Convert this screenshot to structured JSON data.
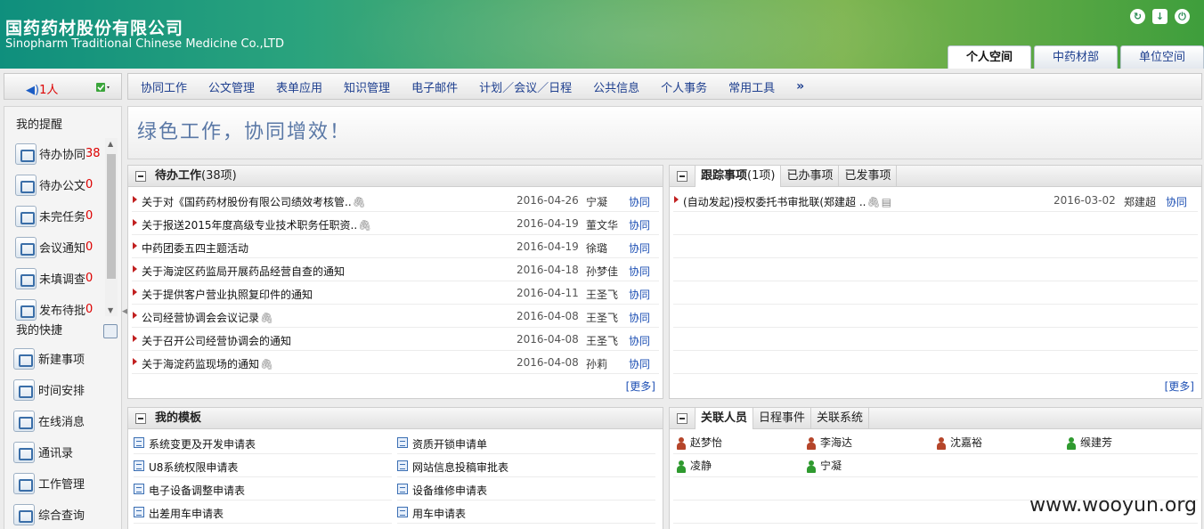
{
  "brand": {
    "cn": "国药药材股份有限公司",
    "en": "Sinopharm Traditional Chinese Medicine Co.,LTD"
  },
  "space_tabs": [
    "个人空间",
    "中药材部",
    "单位空间"
  ],
  "online": {
    "count": "1人"
  },
  "nav": [
    "协同工作",
    "公文管理",
    "表单应用",
    "知识管理",
    "电子邮件",
    "计划／会议／日程",
    "公共信息",
    "个人事务",
    "常用工具"
  ],
  "nav_more": "»",
  "banner": "绿色工作，协同增效！",
  "sidebar": {
    "reminders_title": "我的提醒",
    "reminders": [
      {
        "label": "待办协同",
        "count": "38"
      },
      {
        "label": "待办公文",
        "count": "0"
      },
      {
        "label": "未完任务",
        "count": "0"
      },
      {
        "label": "会议通知",
        "count": "0"
      },
      {
        "label": "未填调查",
        "count": "0"
      },
      {
        "label": "发布待批",
        "count": "0"
      }
    ],
    "shortcuts_title": "我的快捷",
    "shortcuts": [
      "新建事项",
      "时间安排",
      "在线消息",
      "通讯录",
      "工作管理",
      "综合查询"
    ]
  },
  "pending": {
    "title": "待办工作",
    "count": "(38项)",
    "items": [
      {
        "title": "关于对《国药药材股份有限公司绩效考核管..",
        "clip": true,
        "date": "2016-04-26",
        "person": "宁凝",
        "type": "协同"
      },
      {
        "title": "关于报送2015年度高级专业技术职务任职资..",
        "clip": true,
        "date": "2016-04-19",
        "person": "董文华",
        "type": "协同"
      },
      {
        "title": "中药团委五四主题活动",
        "clip": false,
        "date": "2016-04-19",
        "person": "徐璐",
        "type": "协同"
      },
      {
        "title": "关于海淀区药监局开展药品经营自查的通知",
        "clip": false,
        "date": "2016-04-18",
        "person": "孙梦佳",
        "type": "协同"
      },
      {
        "title": "关于提供客户营业执照复印件的通知",
        "clip": false,
        "date": "2016-04-11",
        "person": "王圣飞",
        "type": "协同"
      },
      {
        "title": "公司经营协调会会议记录",
        "clip": true,
        "date": "2016-04-08",
        "person": "王圣飞",
        "type": "协同"
      },
      {
        "title": "关于召开公司经营协调会的通知",
        "clip": false,
        "date": "2016-04-08",
        "person": "王圣飞",
        "type": "协同"
      },
      {
        "title": "关于海淀药监现场的通知",
        "clip": true,
        "date": "2016-04-08",
        "person": "孙莉",
        "type": "协同"
      }
    ],
    "more": "[更多]"
  },
  "tracking": {
    "tabs": [
      {
        "label": "跟踪事项",
        "sub": "(1项)"
      },
      {
        "label": "已办事项"
      },
      {
        "label": "已发事项"
      }
    ],
    "items": [
      {
        "title": "(自动发起)授权委托书审批联(郑建超 ..",
        "date": "2016-03-02",
        "person": "郑建超",
        "type": "协同"
      }
    ],
    "more": "[更多]"
  },
  "templates": {
    "title": "我的模板",
    "items": [
      "系统变更及开发申请表",
      "资质开锁申请单",
      "U8系统权限申请表",
      "网站信息投稿审批表",
      "电子设备调整申请表",
      "设备维修申请表",
      "出差用车申请表",
      "用车申请表"
    ]
  },
  "related": {
    "tabs": [
      "关联人员",
      "日程事件",
      "关联系统"
    ],
    "people": [
      {
        "name": "赵梦怡",
        "color": "#b5452a"
      },
      {
        "name": "李海达",
        "color": "#b5452a"
      },
      {
        "name": "沈嘉裕",
        "color": "#b5452a"
      },
      {
        "name": "缑建芳",
        "color": "#2f9a2f"
      },
      {
        "name": "凌静",
        "color": "#2f9a2f"
      },
      {
        "name": "宁凝",
        "color": "#2f9a2f"
      }
    ]
  },
  "watermark": "www.wooyun.org"
}
